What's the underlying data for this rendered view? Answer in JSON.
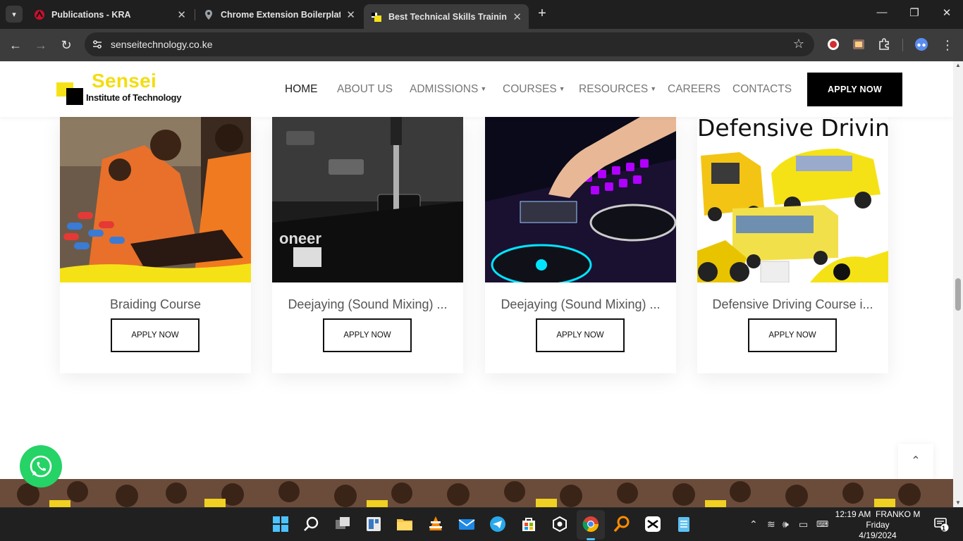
{
  "browser": {
    "tabs": [
      {
        "title": "Publications - KRA",
        "active": false
      },
      {
        "title": "Chrome Extension Boilerplate (",
        "active": false
      },
      {
        "title": "Best Technical Skills Training In",
        "active": true
      }
    ],
    "url": "senseitechnology.co.ke"
  },
  "site": {
    "logo": {
      "name": "Sensei",
      "sub": "Institute of Technology"
    },
    "nav": [
      {
        "label": "HOME",
        "active": true,
        "dropdown": false
      },
      {
        "label": "ABOUT US",
        "active": false,
        "dropdown": false
      },
      {
        "label": "ADMISSIONS",
        "active": false,
        "dropdown": true
      },
      {
        "label": "COURSES",
        "active": false,
        "dropdown": true
      },
      {
        "label": "RESOURCES",
        "active": false,
        "dropdown": true
      },
      {
        "label": "CAREERS",
        "active": false,
        "dropdown": false
      },
      {
        "label": "CONTACTS",
        "active": false,
        "dropdown": false
      }
    ],
    "apply_now": "APPLY NOW",
    "courses": [
      {
        "title": "Braiding Course",
        "button": "APPLY NOW"
      },
      {
        "title": "Deejaying (Sound Mixing) ...",
        "button": "APPLY NOW"
      },
      {
        "title": "Deejaying (Sound Mixing) ...",
        "button": "APPLY NOW"
      },
      {
        "title": "Defensive Driving Course i...",
        "button": "APPLY NOW",
        "image_text": "Defensive Driving"
      }
    ]
  },
  "taskbar": {
    "time": "12:19 AM",
    "user": "FRANKO M",
    "day": "Friday",
    "date": "4/19/2024",
    "notifications": "1"
  },
  "colors": {
    "brand_yellow": "#f5e216",
    "whatsapp": "#25d366",
    "tab_bg": "#1f1f1f"
  }
}
